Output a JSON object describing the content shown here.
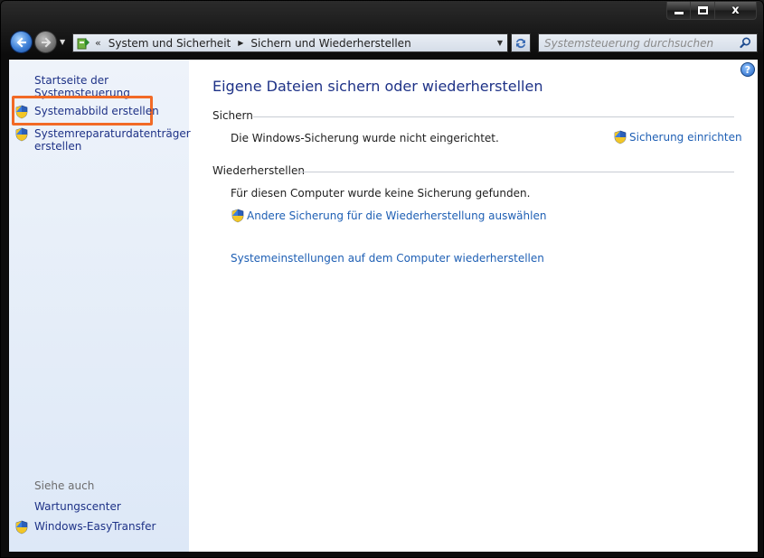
{
  "titlebar": {
    "minimize_glyph": "",
    "maximize_glyph": "",
    "close_glyph": "x"
  },
  "address": {
    "chevron": "«",
    "crumbs": [
      "System und Sicherheit",
      "Sichern und Wiederherstellen"
    ]
  },
  "search": {
    "placeholder": "Systemsteuerung durchsuchen"
  },
  "sidebar": {
    "home_link": "Startseite der Systemsteuerung",
    "items": [
      {
        "label": "Systemabbild erstellen",
        "icon": "shield-icon",
        "highlighted": true
      },
      {
        "label": "Systemreparaturdatenträger erstellen",
        "icon": "shield-icon"
      }
    ],
    "see_also": {
      "heading": "Siehe auch",
      "links": [
        {
          "label": "Wartungscenter",
          "icon": ""
        },
        {
          "label": "Windows-EasyTransfer",
          "icon": "shield-icon"
        }
      ]
    }
  },
  "main": {
    "title": "Eigene Dateien sichern oder wiederherstellen",
    "help_glyph": "?",
    "backup": {
      "heading": "Sichern",
      "status": "Die Windows-Sicherung wurde nicht eingerichtet.",
      "setup_link": "Sicherung einrichten"
    },
    "restore": {
      "heading": "Wiederherstellen",
      "status": "Für diesen Computer wurde keine Sicherung gefunden.",
      "select_link": "Andere Sicherung für die Wiederherstellung auswählen",
      "system_restore_link": "Systemeinstellungen auf dem Computer wiederherstellen"
    }
  },
  "colors": {
    "link": "#1e5fb4",
    "sidebar_link": "#1e3287",
    "highlight": "#f26a26"
  }
}
